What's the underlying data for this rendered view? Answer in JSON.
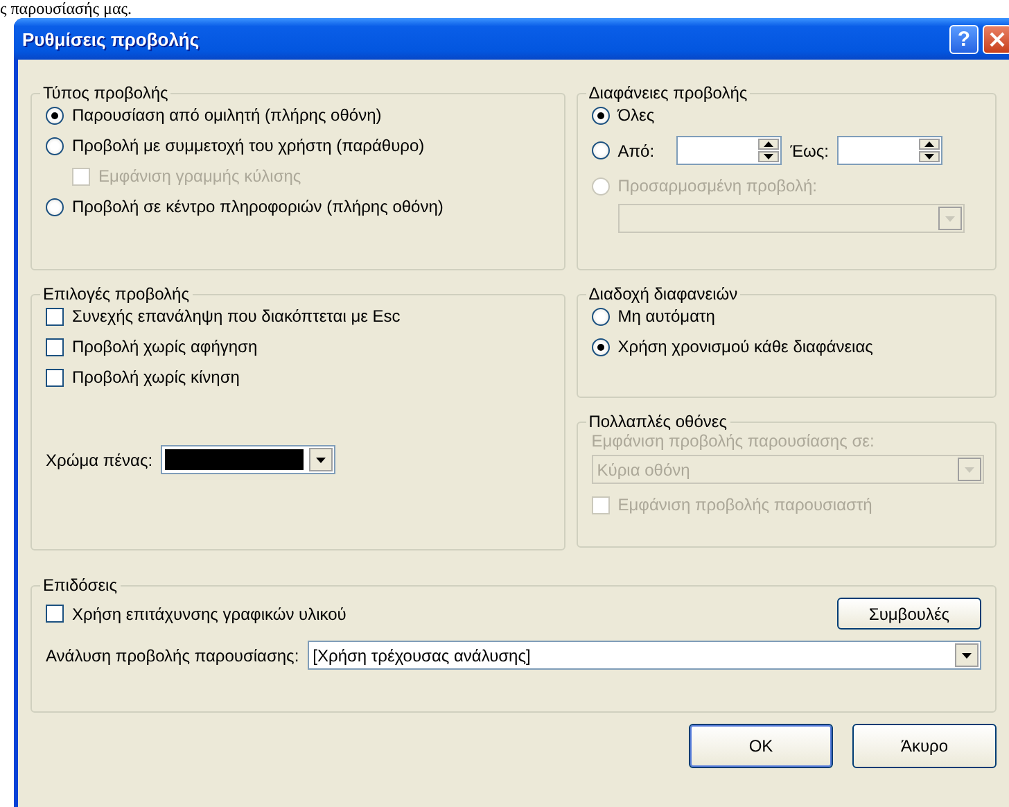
{
  "background_text": "ς παρουσίασής μας.",
  "window": {
    "title": "Ρυθμίσεις προβολής",
    "help_label": "?"
  },
  "show_type": {
    "title": "Τύπος προβολής",
    "options": [
      {
        "kind": "radio",
        "label": "Παρουσίαση από ομιλητή (πλήρης οθόνη)",
        "selected": true,
        "disabled": false
      },
      {
        "kind": "radio",
        "label": "Προβολή με συμμετοχή του χρήστη (παράθυρο)",
        "selected": false,
        "disabled": false
      },
      {
        "kind": "checkbox",
        "label": "Εμφάνιση γραμμής κύλισης",
        "checked": false,
        "disabled": true
      },
      {
        "kind": "radio",
        "label": "Προβολή σε κέντρο πληροφοριών (πλήρης οθόνη)",
        "selected": false,
        "disabled": false
      }
    ]
  },
  "slides": {
    "title": "Διαφάνειες προβολής",
    "options": [
      {
        "kind": "radio",
        "label": "Όλες",
        "selected": true,
        "disabled": false
      },
      {
        "kind": "range",
        "label": "Από:",
        "to_label": "Έως:",
        "selected": false,
        "disabled": false
      },
      {
        "kind": "radio",
        "label": "Προσαρμοσμένη προβολή:",
        "selected": false,
        "disabled": true
      }
    ],
    "custom_show": {
      "disabled": true
    }
  },
  "show_options": {
    "title": "Επιλογές προβολής",
    "options": [
      {
        "kind": "checkbox",
        "label": "Συνεχής επανάληψη που διακόπτεται με Esc",
        "checked": false,
        "disabled": false
      },
      {
        "kind": "checkbox",
        "label": "Προβολή χωρίς αφήγηση",
        "checked": false,
        "disabled": false
      },
      {
        "kind": "checkbox",
        "label": "Προβολή χωρίς κίνηση",
        "checked": false,
        "disabled": false
      }
    ],
    "pen_color": {
      "label": "Χρώμα πένας:",
      "color": "#000000"
    }
  },
  "advance": {
    "title": "Διαδοχή διαφανειών",
    "options": [
      {
        "kind": "radio",
        "label": "Μη αυτόματη",
        "selected": false,
        "disabled": false
      },
      {
        "kind": "radio",
        "label": "Χρήση χρονισμού κάθε διαφάνειας",
        "selected": true,
        "disabled": false
      }
    ]
  },
  "monitors": {
    "title": "Πολλαπλές οθόνες",
    "disabled": true,
    "label": "Εμφάνιση προβολής παρουσίασης σε:",
    "value": "Κύρια οθόνη",
    "options": [
      {
        "kind": "checkbox",
        "label": "Εμφάνιση προβολής παρουσιαστή",
        "checked": false,
        "disabled": true
      }
    ]
  },
  "performance": {
    "title": "Επιδόσεις",
    "options": [
      {
        "kind": "checkbox",
        "label": "Χρήση επιτάχυνσης γραφικών υλικού",
        "checked": false,
        "disabled": false
      }
    ],
    "tips_button": "Συμβουλές",
    "resolution_label": "Ανάλυση προβολής παρουσίασης:",
    "resolution_value": "[Χρήση τρέχουσας ανάλυσης]"
  },
  "buttons": [
    {
      "label": "OK",
      "default": true
    },
    {
      "label": "Άκυρο",
      "default": false
    }
  ]
}
